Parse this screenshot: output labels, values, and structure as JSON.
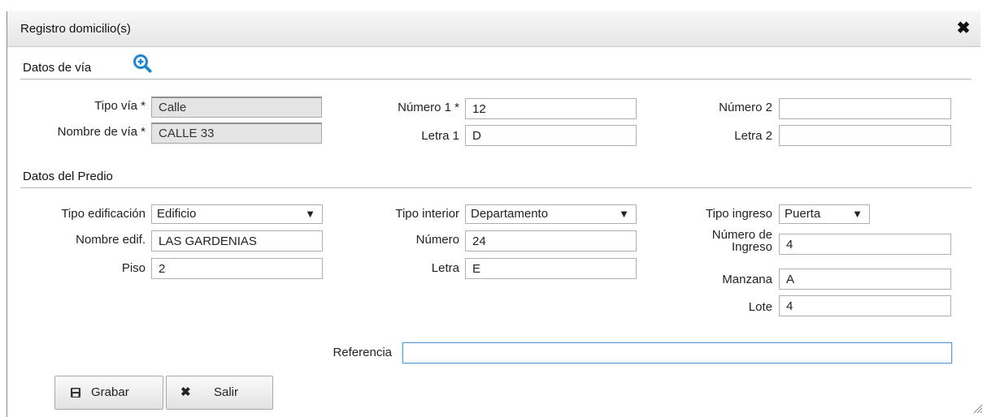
{
  "dialog": {
    "title": "Registro domicilio(s)",
    "close_icon": "close-icon"
  },
  "via": {
    "section_title": "Datos de vía",
    "tipo_via_label": "Tipo vía *",
    "tipo_via_value": "Calle",
    "nombre_via_label": "Nombre de vía *",
    "nombre_via_value": "CALLE 33",
    "numero1_label": "Número 1 *",
    "numero1_value": "12",
    "letra1_label": "Letra 1",
    "letra1_value": "D",
    "numero2_label": "Número 2",
    "numero2_value": "",
    "letra2_label": "Letra 2",
    "letra2_value": ""
  },
  "predio": {
    "section_title": "Datos del Predio",
    "tipo_edificacion_label": "Tipo edificación",
    "tipo_edificacion_value": "Edificio",
    "nombre_edif_label": "Nombre edif.",
    "nombre_edif_value": "LAS GARDENIAS",
    "piso_label": "Piso",
    "piso_value": "2",
    "tipo_interior_label": "Tipo interior",
    "tipo_interior_value": "Departamento",
    "numero_label": "Número",
    "numero_value": "24",
    "letra_label": "Letra",
    "letra_value": "E",
    "tipo_ingreso_label": "Tipo ingreso",
    "tipo_ingreso_value": "Puerta",
    "numero_ingreso_label_1": "Número de",
    "numero_ingreso_label_2": "Ingreso",
    "numero_ingreso_value": "4",
    "manzana_label": "Manzana",
    "manzana_value": "A",
    "lote_label": "Lote",
    "lote_value": "4",
    "referencia_label": "Referencia",
    "referencia_value": ""
  },
  "buttons": {
    "grabar": "Grabar",
    "salir": "Salir"
  },
  "dropdown_arrow": "▼"
}
